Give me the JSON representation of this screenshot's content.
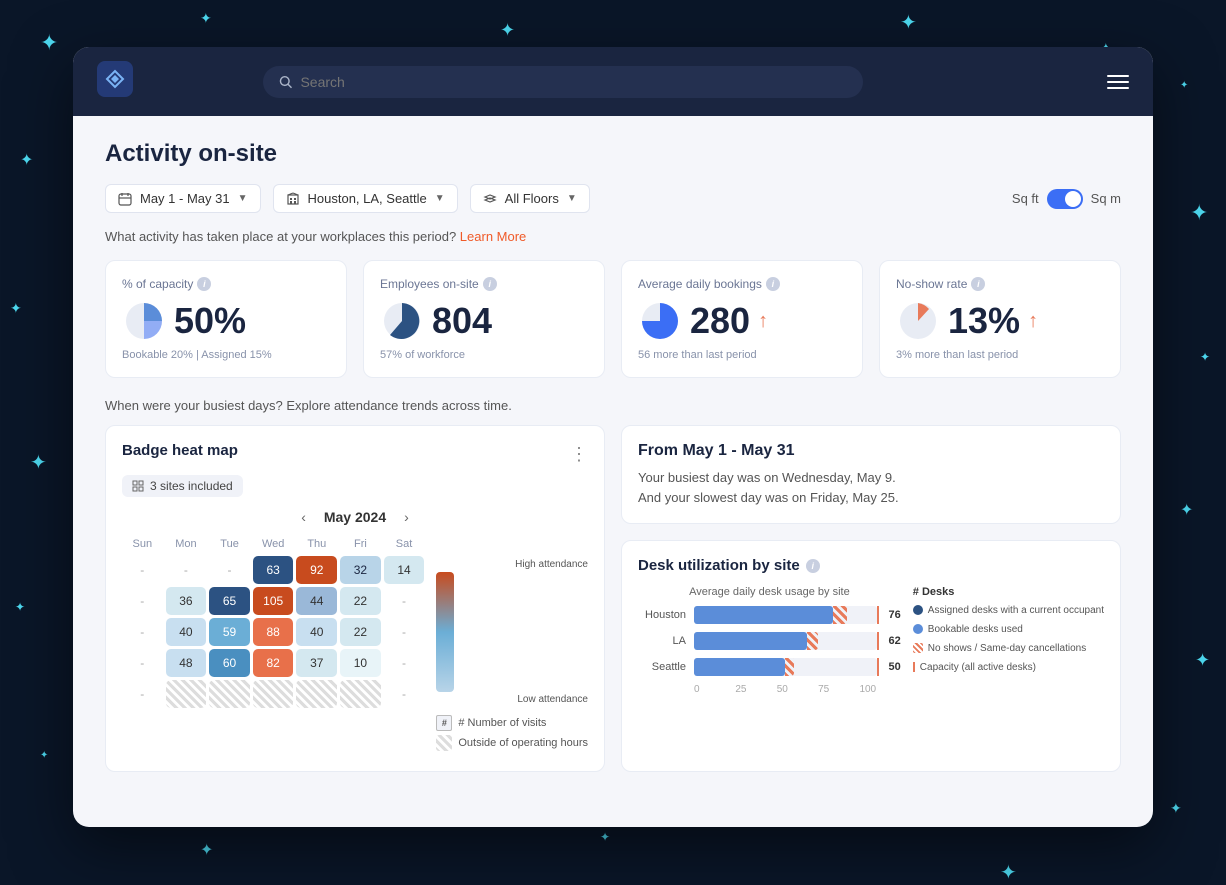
{
  "meta": {
    "title": "Activity on-site",
    "bg_color": "#0a1628"
  },
  "header": {
    "search_placeholder": "Search",
    "menu_label": "Menu"
  },
  "filters": {
    "date_range": "May 1 - May 31",
    "location": "Houston, LA, Seattle",
    "floor": "All Floors",
    "sq_ft_label": "Sq ft",
    "sq_m_label": "Sq m"
  },
  "info_text": "What activity has taken place at your workplaces this period?",
  "learn_more": "Learn More",
  "metrics": [
    {
      "label": "% of capacity",
      "value": "50%",
      "sub": "Bookable 20%  |  Assigned 15%",
      "has_arrow": false,
      "pie_type": "half_blue"
    },
    {
      "label": "Employees on-site",
      "value": "804",
      "sub": "57% of workforce",
      "has_arrow": false,
      "pie_type": "mostly_blue"
    },
    {
      "label": "Average daily bookings",
      "value": "280",
      "sub": "56 more than last period",
      "has_arrow": true,
      "pie_type": "half_blue"
    },
    {
      "label": "No-show rate",
      "value": "13%",
      "sub": "3% more than last period",
      "has_arrow": true,
      "pie_type": "small_pink",
      "arrow_color": "#e87a5a"
    }
  ],
  "busiest_text": "When were your busiest days? Explore attendance trends across time.",
  "heatmap": {
    "title": "Badge heat map",
    "sites_label": "3 sites included",
    "month": "May 2024",
    "days": [
      "Sun",
      "Mon",
      "Tue",
      "Wed",
      "Thu",
      "Fri",
      "Sat"
    ],
    "rows": [
      [
        null,
        null,
        null,
        "63",
        "92",
        "32",
        "14"
      ],
      [
        null,
        "36",
        "65",
        "105",
        "44",
        "22",
        null
      ],
      [
        null,
        "40",
        "59",
        "88",
        "40",
        "22",
        null
      ],
      [
        null,
        "48",
        "60",
        "82",
        "37",
        "10",
        null
      ],
      [
        null,
        null,
        null,
        null,
        null,
        null,
        null
      ]
    ],
    "row_colors": [
      [
        "empty",
        "empty",
        "empty",
        "high",
        "vhot",
        "low",
        "low2"
      ],
      [
        "dash",
        "low2",
        "high",
        "vhot2",
        "low",
        "low2",
        "dash"
      ],
      [
        "dash",
        "low2",
        "medium",
        "vhot",
        "low",
        "low2",
        "dash"
      ],
      [
        "dash",
        "low",
        "medium",
        "vhot",
        "low",
        "low2",
        "dash"
      ],
      [
        "dash",
        "stripe",
        "stripe",
        "stripe",
        "stripe",
        "stripe",
        "dash"
      ]
    ]
  },
  "attendance_legend": {
    "high": "High attendance",
    "low": "Low attendance",
    "number_visits": "# Number of visits",
    "outside_hours": "Outside of operating hours"
  },
  "date_range_panel": {
    "title": "From May 1 - May 31",
    "busiest": "Your busiest day was on Wednesday,  May 9.",
    "slowest": "And your slowest day was on Friday, May 25."
  },
  "desk_util": {
    "title": "Desk utilization by site",
    "chart_title": "Average daily desk usage by site",
    "bars": [
      {
        "site": "Houston",
        "value": 76,
        "max": 100
      },
      {
        "site": "LA",
        "value": 62,
        "max": 100
      },
      {
        "site": "Seattle",
        "value": 50,
        "max": 100
      }
    ],
    "axis": [
      "0",
      "25",
      "50",
      "75",
      "100"
    ],
    "legend_title": "# Desks",
    "legend_items": [
      {
        "color": "#2c5282",
        "type": "dot",
        "label": "Assigned desks with a current occupant"
      },
      {
        "color": "#5b8dd9",
        "type": "dot",
        "label": "Bookable desks used"
      },
      {
        "color": "#e87a5a",
        "type": "stripe",
        "label": "No shows / Same-day cancellations"
      },
      {
        "color": "#e87a5a",
        "type": "line",
        "label": "Capacity (all active desks)"
      }
    ]
  }
}
